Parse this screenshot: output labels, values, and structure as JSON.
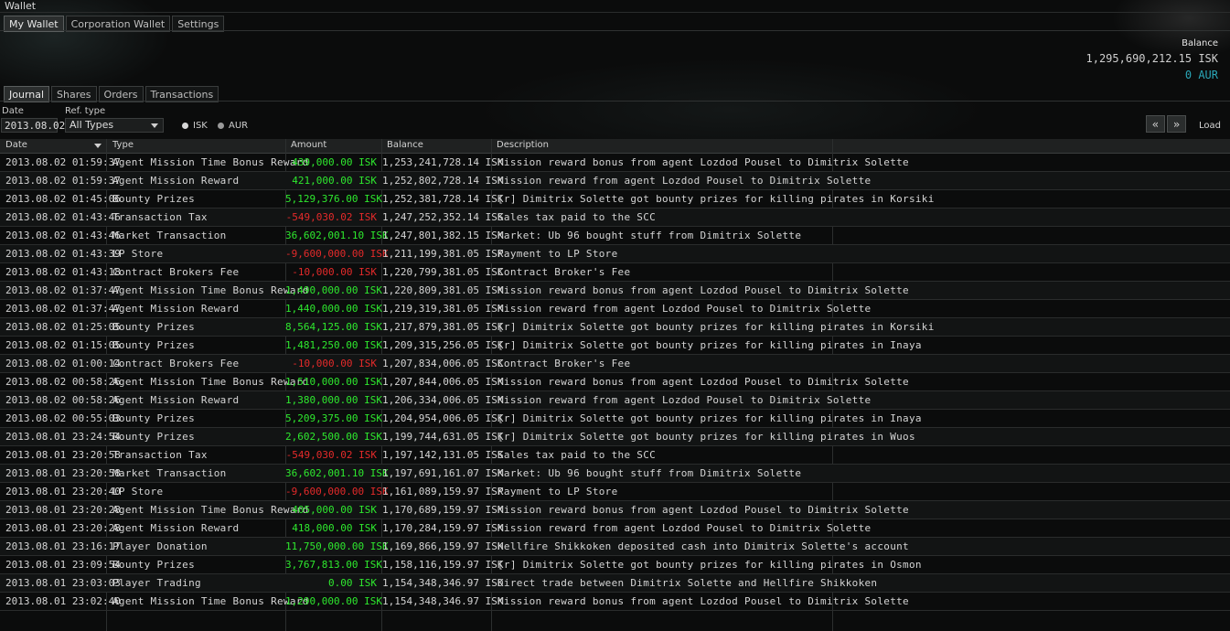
{
  "window": {
    "title": "Wallet"
  },
  "top_tabs": [
    "My Wallet",
    "Corporation Wallet",
    "Settings"
  ],
  "balance": {
    "label": "Balance",
    "isk": "1,295,690,212.15 ISK",
    "aur": "0 AUR"
  },
  "sub_tabs": [
    "Journal",
    "Shares",
    "Orders",
    "Transactions"
  ],
  "filters": {
    "date_label": "Date",
    "date_value": "2013.08.02",
    "reftype_label": "Ref. type",
    "reftype_value": "All Types",
    "radio_isk": "ISK",
    "radio_aur": "AUR",
    "selected_currency": "ISK",
    "prev_icon": "«",
    "next_icon": "»",
    "load_label": "Load"
  },
  "columns": [
    "Date",
    "Type",
    "Amount",
    "Balance",
    "Description"
  ],
  "colors": {
    "positive": "#2ee82e",
    "negative": "#e42a2a",
    "aur": "#2aa7b8"
  },
  "rows": [
    {
      "date": "2013.08.02 01:59:37",
      "type": "Agent Mission Time Bonus Reward",
      "amount": "439,000.00 ISK",
      "sign": "pos",
      "balance": "1,253,241,728.14 ISK",
      "desc": "Mission reward bonus from agent Lozdod Pousel to Dimitrix Solette"
    },
    {
      "date": "2013.08.02 01:59:37",
      "type": "Agent Mission Reward",
      "amount": "421,000.00 ISK",
      "sign": "pos",
      "balance": "1,252,802,728.14 ISK",
      "desc": "Mission reward from agent Lozdod Pousel to Dimitrix Solette"
    },
    {
      "date": "2013.08.02 01:45:06",
      "type": "Bounty Prizes",
      "amount": "5,129,376.00 ISK",
      "sign": "pos",
      "balance": "1,252,381,728.14 ISK",
      "desc": "[r] Dimitrix Solette got bounty prizes for killing pirates in Korsiki"
    },
    {
      "date": "2013.08.02 01:43:46",
      "type": "Transaction Tax",
      "amount": "-549,030.02 ISK",
      "sign": "neg",
      "balance": "1,247,252,352.14 ISK",
      "desc": "Sales tax paid to the SCC"
    },
    {
      "date": "2013.08.02 01:43:46",
      "type": "Market Transaction",
      "amount": "36,602,001.10 ISK",
      "sign": "pos",
      "balance": "1,247,801,382.15 ISK",
      "desc": "Market: Ub 96 bought stuff from Dimitrix Solette"
    },
    {
      "date": "2013.08.02 01:43:39",
      "type": "LP Store",
      "amount": "-9,600,000.00 ISK",
      "sign": "neg",
      "balance": "1,211,199,381.05 ISK",
      "desc": "Payment to LP Store"
    },
    {
      "date": "2013.08.02 01:43:18",
      "type": "Contract Brokers Fee",
      "amount": "-10,000.00 ISK",
      "sign": "neg",
      "balance": "1,220,799,381.05 ISK",
      "desc": "Contract Broker's Fee"
    },
    {
      "date": "2013.08.02 01:37:47",
      "type": "Agent Mission Time Bonus Reward",
      "amount": "1,490,000.00 ISK",
      "sign": "pos",
      "balance": "1,220,809,381.05 ISK",
      "desc": "Mission reward bonus from agent Lozdod Pousel to Dimitrix Solette"
    },
    {
      "date": "2013.08.02 01:37:47",
      "type": "Agent Mission Reward",
      "amount": "1,440,000.00 ISK",
      "sign": "pos",
      "balance": "1,219,319,381.05 ISK",
      "desc": "Mission reward from agent Lozdod Pousel to Dimitrix Solette"
    },
    {
      "date": "2013.08.02 01:25:05",
      "type": "Bounty Prizes",
      "amount": "8,564,125.00 ISK",
      "sign": "pos",
      "balance": "1,217,879,381.05 ISK",
      "desc": "[r] Dimitrix Solette got bounty prizes for killing pirates in Korsiki"
    },
    {
      "date": "2013.08.02 01:15:05",
      "type": "Bounty Prizes",
      "amount": "1,481,250.00 ISK",
      "sign": "pos",
      "balance": "1,209,315,256.05 ISK",
      "desc": "[r] Dimitrix Solette got bounty prizes for killing pirates in Inaya"
    },
    {
      "date": "2013.08.02 01:00:14",
      "type": "Contract Brokers Fee",
      "amount": "-10,000.00 ISK",
      "sign": "neg",
      "balance": "1,207,834,006.05 ISK",
      "desc": "Contract Broker's Fee"
    },
    {
      "date": "2013.08.02 00:58:26",
      "type": "Agent Mission Time Bonus Reward",
      "amount": "1,510,000.00 ISK",
      "sign": "pos",
      "balance": "1,207,844,006.05 ISK",
      "desc": "Mission reward bonus from agent Lozdod Pousel to Dimitrix Solette"
    },
    {
      "date": "2013.08.02 00:58:26",
      "type": "Agent Mission Reward",
      "amount": "1,380,000.00 ISK",
      "sign": "pos",
      "balance": "1,206,334,006.05 ISK",
      "desc": "Mission reward from agent Lozdod Pousel to Dimitrix Solette"
    },
    {
      "date": "2013.08.02 00:55:03",
      "type": "Bounty Prizes",
      "amount": "5,209,375.00 ISK",
      "sign": "pos",
      "balance": "1,204,954,006.05 ISK",
      "desc": "[r] Dimitrix Solette got bounty prizes for killing pirates in Inaya"
    },
    {
      "date": "2013.08.01 23:24:54",
      "type": "Bounty Prizes",
      "amount": "2,602,500.00 ISK",
      "sign": "pos",
      "balance": "1,199,744,631.05 ISK",
      "desc": "[r] Dimitrix Solette got bounty prizes for killing pirates in Wuos"
    },
    {
      "date": "2013.08.01 23:20:58",
      "type": "Transaction Tax",
      "amount": "-549,030.02 ISK",
      "sign": "neg",
      "balance": "1,197,142,131.05 ISK",
      "desc": "Sales tax paid to the SCC"
    },
    {
      "date": "2013.08.01 23:20:58",
      "type": "Market Transaction",
      "amount": "36,602,001.10 ISK",
      "sign": "pos",
      "balance": "1,197,691,161.07 ISK",
      "desc": "Market: Ub 96 bought stuff from Dimitrix Solette"
    },
    {
      "date": "2013.08.01 23:20:40",
      "type": "LP Store",
      "amount": "-9,600,000.00 ISK",
      "sign": "neg",
      "balance": "1,161,089,159.97 ISK",
      "desc": "Payment to LP Store"
    },
    {
      "date": "2013.08.01 23:20:28",
      "type": "Agent Mission Time Bonus Reward",
      "amount": "405,000.00 ISK",
      "sign": "pos",
      "balance": "1,170,689,159.97 ISK",
      "desc": "Mission reward bonus from agent Lozdod Pousel to Dimitrix Solette"
    },
    {
      "date": "2013.08.01 23:20:28",
      "type": "Agent Mission Reward",
      "amount": "418,000.00 ISK",
      "sign": "pos",
      "balance": "1,170,284,159.97 ISK",
      "desc": "Mission reward from agent Lozdod Pousel to Dimitrix Solette"
    },
    {
      "date": "2013.08.01 23:16:17",
      "type": "Player Donation",
      "amount": "11,750,000.00 ISK",
      "sign": "pos",
      "balance": "1,169,866,159.97 ISK",
      "desc": "Hellfire Shikkoken deposited cash into Dimitrix Solette's account"
    },
    {
      "date": "2013.08.01 23:09:54",
      "type": "Bounty Prizes",
      "amount": "3,767,813.00 ISK",
      "sign": "pos",
      "balance": "1,158,116,159.97 ISK",
      "desc": "[r] Dimitrix Solette got bounty prizes for killing pirates in Osmon"
    },
    {
      "date": "2013.08.01 23:03:03",
      "type": "Player Trading",
      "amount": "0.00 ISK",
      "sign": "pos",
      "balance": "1,154,348,346.97 ISK",
      "desc": "Direct trade between Dimitrix Solette and Hellfire Shikkoken"
    },
    {
      "date": "2013.08.01 23:02:40",
      "type": "Agent Mission Time Bonus Reward",
      "amount": "1,290,000.00 ISK",
      "sign": "pos",
      "balance": "1,154,348,346.97 ISK",
      "desc": "Mission reward bonus from agent Lozdod Pousel to Dimitrix Solette"
    }
  ]
}
